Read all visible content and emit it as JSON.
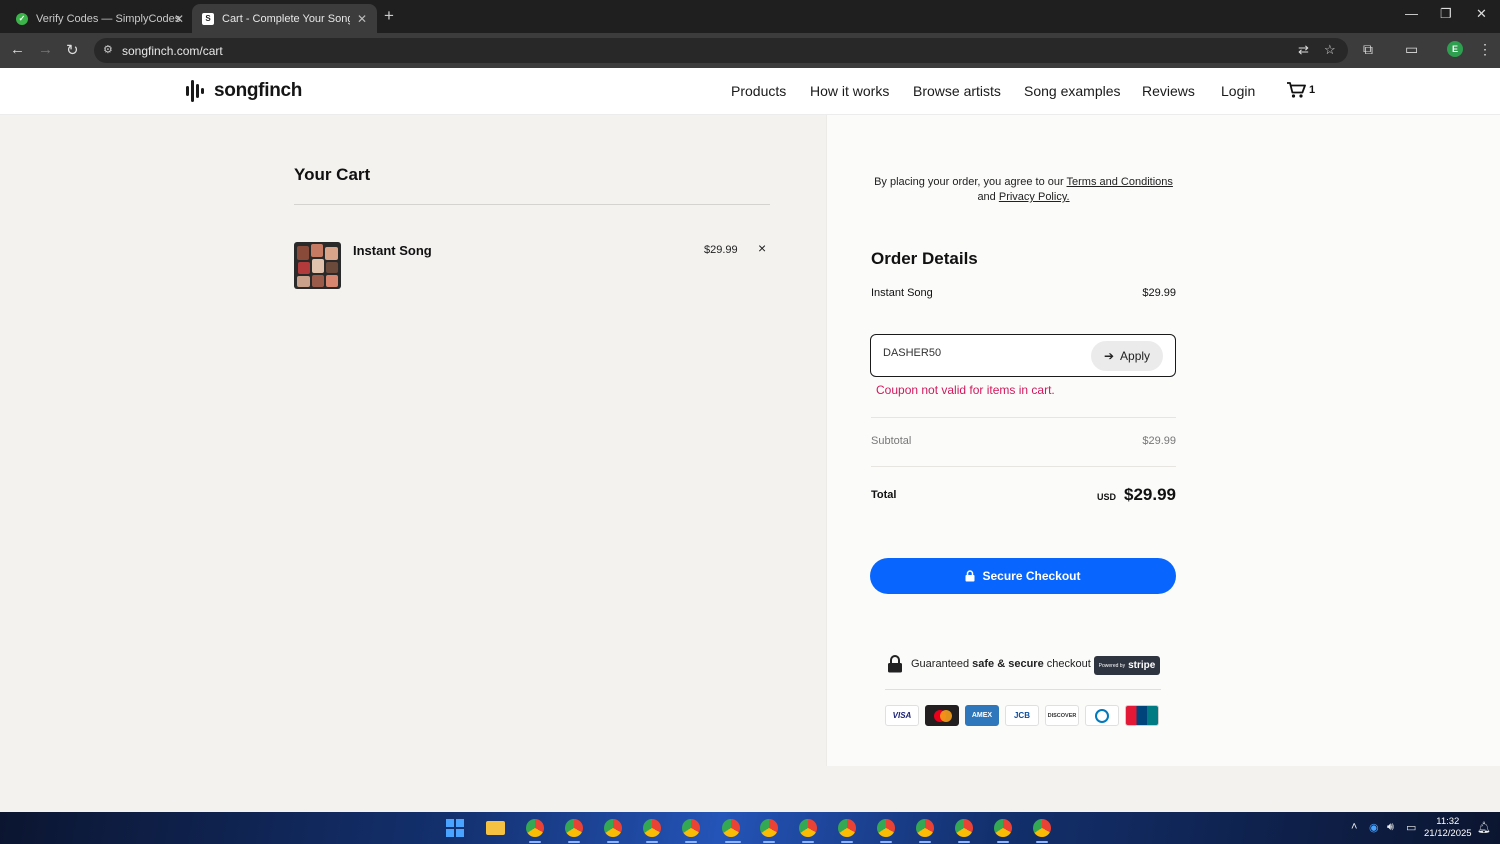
{
  "browser": {
    "tabs": [
      {
        "title": "Verify Codes — SimplyCodes",
        "active": false,
        "favicon": "check-circle-icon",
        "favicon_color": "#3bb54a"
      },
      {
        "title": "Cart - Complete Your Song on …",
        "active": true,
        "favicon": "s-logo-icon",
        "favicon_color": "#ffffff"
      }
    ],
    "url": "songfinch.com/cart"
  },
  "site": {
    "brand": "songfinch",
    "nav": [
      "Products",
      "How it works",
      "Browse artists",
      "Song examples",
      "Reviews",
      "Login"
    ],
    "cart_count": "1"
  },
  "cart": {
    "title": "Your Cart",
    "items": [
      {
        "name": "Instant Song",
        "price": "$29.99",
        "remove_label": "×"
      }
    ]
  },
  "order": {
    "terms_prefix": "By placing your order, you agree to our ",
    "terms_link": "Terms and Conditions",
    "terms_mid": " and ",
    "privacy_link": "Privacy Policy.",
    "title": "Order Details",
    "line_item": {
      "name": "Instant Song",
      "price": "$29.99"
    },
    "coupon": {
      "value": "DASHER50",
      "apply_label": "Apply"
    },
    "error": "Coupon not valid for items in cart.",
    "subtotal_label": "Subtotal",
    "subtotal": "$29.99",
    "total_label": "Total",
    "currency": "USD",
    "total": "$29.99",
    "checkout_label": "Secure Checkout",
    "secure_prefix": "Guaranteed ",
    "secure_bold": "safe & secure",
    "secure_suffix": " checkout",
    "stripe_powered": "Powered by",
    "stripe_brand": "stripe",
    "payment_methods": [
      "VISA",
      "Mastercard",
      "AMEX",
      "JCB",
      "DISCOVER",
      "Diners",
      "UnionPay"
    ],
    "accent_color": "#0866ff",
    "error_color": "#d2185b"
  },
  "taskbar": {
    "time": "11:32",
    "date": "21/12/2025"
  }
}
